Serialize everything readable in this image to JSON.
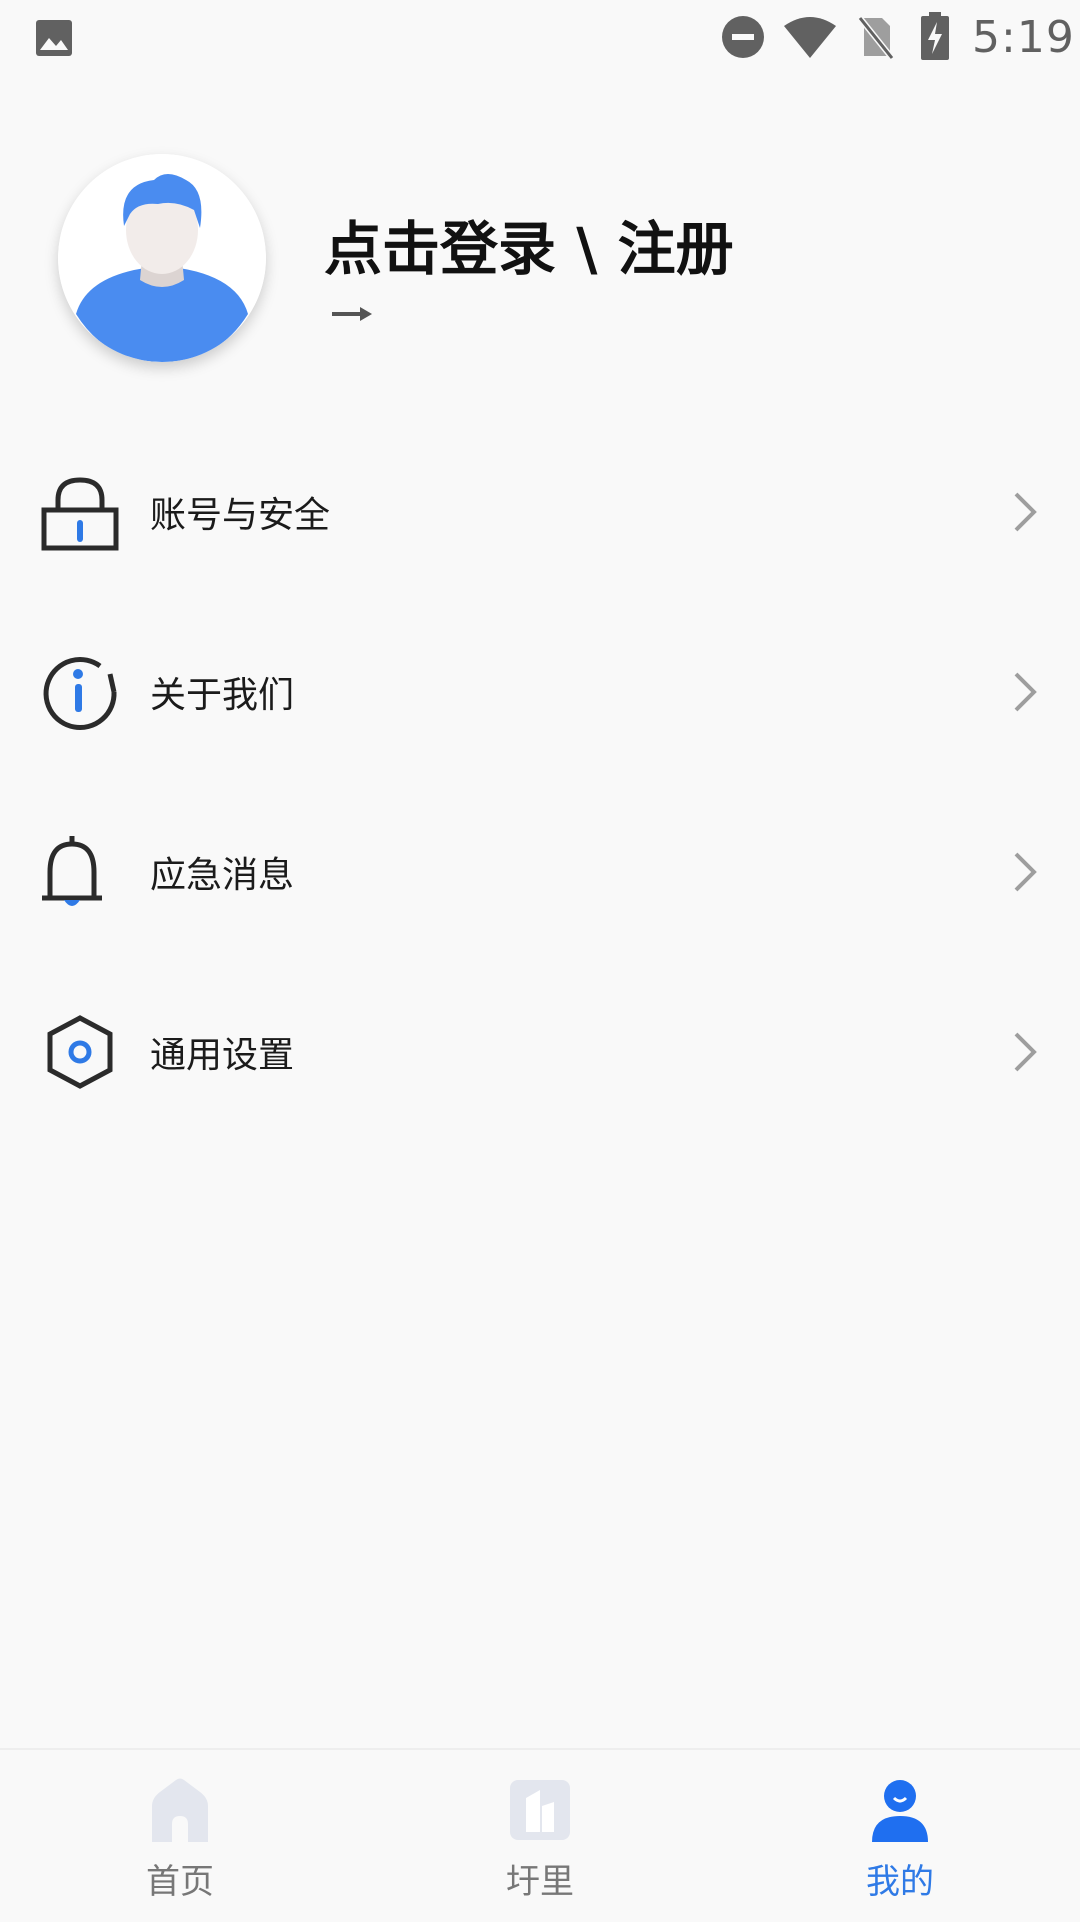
{
  "status_bar": {
    "time": "5:19",
    "icons": [
      "gallery-icon",
      "do-not-disturb-icon",
      "wifi-icon",
      "no-sim-icon",
      "battery-charging-icon"
    ]
  },
  "profile": {
    "title": "点击登录 \\ 注册",
    "arrow": "→",
    "avatar_icon": "user-avatar-icon"
  },
  "menu": {
    "items": [
      {
        "label": "账号与安全",
        "icon": "lock-icon"
      },
      {
        "label": "关于我们",
        "icon": "info-icon"
      },
      {
        "label": "应急消息",
        "icon": "bell-icon"
      },
      {
        "label": "通用设置",
        "icon": "settings-icon"
      }
    ]
  },
  "bottom_nav": {
    "tabs": [
      {
        "label": "首页",
        "icon": "home-icon",
        "active": false
      },
      {
        "label": "圩里",
        "icon": "building-icon",
        "active": false
      },
      {
        "label": "我的",
        "icon": "profile-icon",
        "active": true
      }
    ]
  },
  "colors": {
    "accent": "#2f7ae6",
    "icon_dark": "#2b2b2b",
    "inactive_nav": "#e3e6ee",
    "background": "#f9f9f9"
  }
}
